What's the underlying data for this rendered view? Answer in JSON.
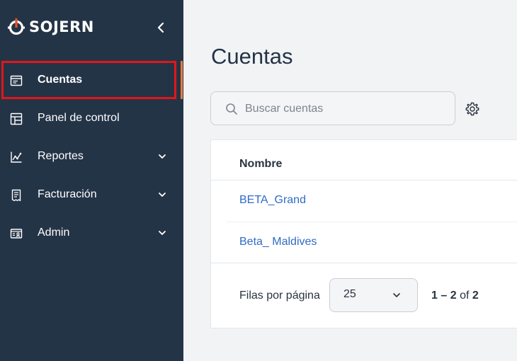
{
  "brand": {
    "name": "SOJERN",
    "accent": "#e8512a"
  },
  "sidebar": {
    "items": [
      {
        "label": "Cuentas",
        "icon": "window-icon",
        "active": true,
        "expandable": false
      },
      {
        "label": "Panel de control",
        "icon": "dashboard-icon",
        "active": false,
        "expandable": false
      },
      {
        "label": "Reportes",
        "icon": "chart-icon",
        "active": false,
        "expandable": true
      },
      {
        "label": "Facturación",
        "icon": "receipt-icon",
        "active": false,
        "expandable": true
      },
      {
        "label": "Admin",
        "icon": "id-card-icon",
        "active": false,
        "expandable": true
      }
    ]
  },
  "main": {
    "title": "Cuentas",
    "search": {
      "placeholder": "Buscar cuentas",
      "value": ""
    },
    "table": {
      "column": "Nombre",
      "rows": [
        "BETA_Grand",
        "Beta_ Maldives"
      ]
    },
    "pagination": {
      "rows_per_page_label": "Filas por página",
      "rows_per_page": "25",
      "range_start": "1",
      "range_end": "2",
      "range_of": "of",
      "total": "2"
    }
  },
  "colors": {
    "sidebar_bg": "#243447",
    "highlight": "#e3151a",
    "link": "#2e6bc6",
    "active_bar": "#f47a3e"
  }
}
